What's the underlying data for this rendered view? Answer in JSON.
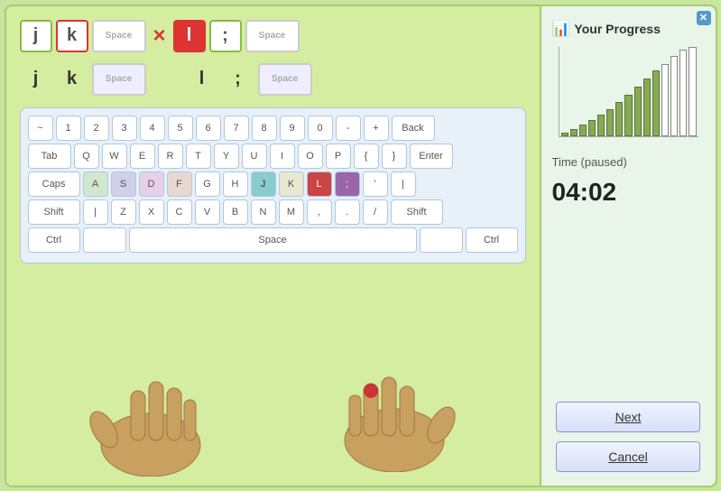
{
  "window": {
    "close_label": "✕"
  },
  "progress": {
    "title": "Your Progress",
    "chart_bars": [
      3,
      8,
      12,
      15,
      20,
      26,
      30,
      35,
      42,
      48,
      55,
      62,
      70,
      80,
      90
    ],
    "filled_count": 12,
    "time_label": "Time (paused)",
    "time_value": "04:02"
  },
  "lesson": {
    "target_chars": [
      "j",
      "k",
      "Space",
      "×",
      "l",
      ";",
      "Space"
    ],
    "typed_chars": [
      "j",
      "k",
      "Space",
      "",
      "l",
      ";",
      "Space"
    ]
  },
  "keyboard": {
    "rows": [
      [
        "~",
        "1",
        "2",
        "3",
        "4",
        "5",
        "6",
        "7",
        "8",
        "9",
        "0",
        "-",
        "+",
        "Back"
      ],
      [
        "Tab",
        "Q",
        "W",
        "E",
        "R",
        "T",
        "Y",
        "U",
        "I",
        "O",
        "P",
        "{",
        "}",
        "Enter"
      ],
      [
        "Caps",
        "A",
        "S",
        "D",
        "F",
        "G",
        "H",
        "J",
        "K",
        "L",
        ";",
        "'"
      ],
      [
        "Shift",
        "",
        "Z",
        "X",
        "C",
        "V",
        "B",
        "N",
        "M",
        ",",
        ".",
        "/",
        "Shift"
      ],
      [
        "Ctrl",
        "",
        "Space",
        "",
        "Ctrl"
      ]
    ]
  },
  "buttons": {
    "next_label": "Next",
    "cancel_label": "Cancel"
  }
}
